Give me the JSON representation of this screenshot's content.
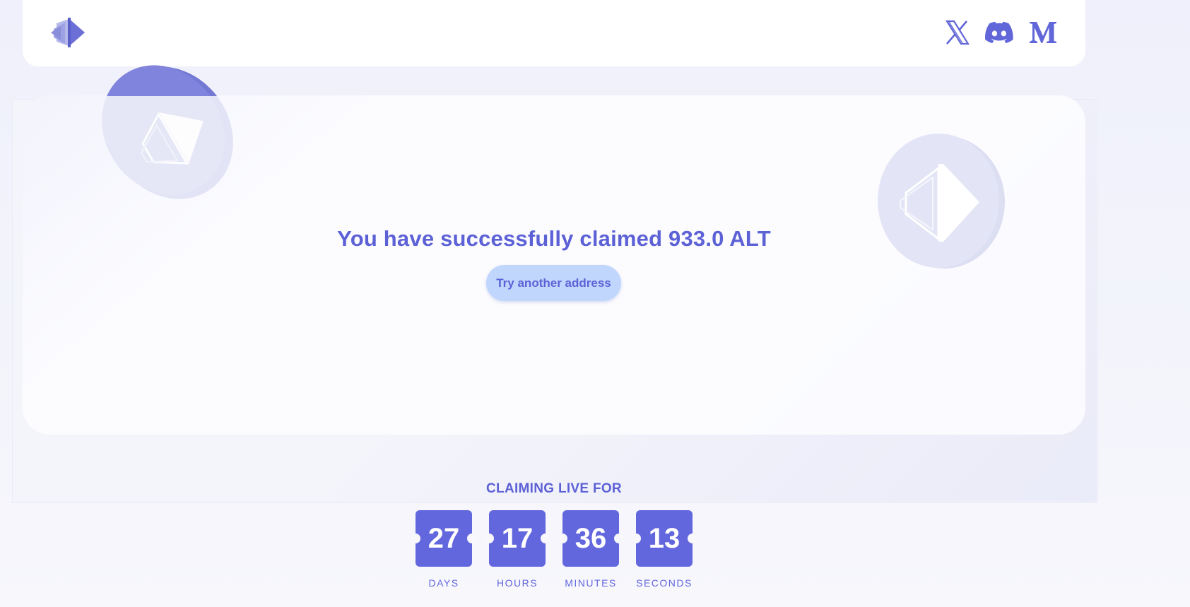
{
  "header": {
    "logo": "altlayer-logo",
    "socials": [
      {
        "name": "x-twitter",
        "icon": "x-icon"
      },
      {
        "name": "discord",
        "icon": "discord-icon"
      },
      {
        "name": "medium",
        "icon": "medium-icon"
      }
    ]
  },
  "claim": {
    "message": "You have successfully claimed 933.0 ALT",
    "button_label": "Try another address"
  },
  "countdown": {
    "title": "CLAIMING LIVE FOR",
    "units": [
      {
        "value": "27",
        "label": "DAYS"
      },
      {
        "value": "17",
        "label": "HOURS"
      },
      {
        "value": "36",
        "label": "MINUTES"
      },
      {
        "value": "13",
        "label": "SECONDS"
      }
    ]
  },
  "colors": {
    "accent": "#6367de",
    "text_primary": "#5c61d6",
    "button_bg": "#c0d6fd",
    "page_bg": "#eff0fb"
  }
}
